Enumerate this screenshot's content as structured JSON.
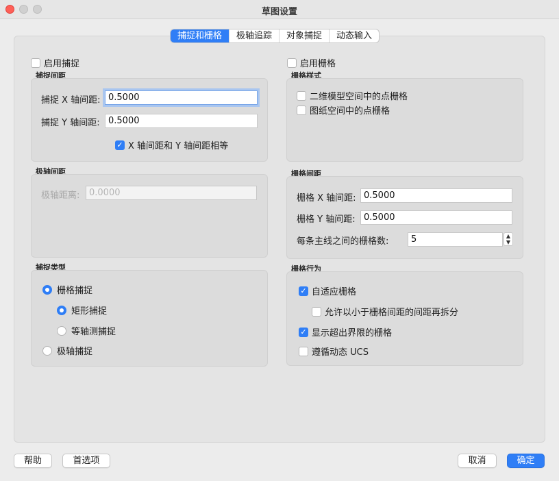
{
  "window": {
    "title": "草图设置"
  },
  "tabs": [
    {
      "label": "捕捉和栅格",
      "active": true
    },
    {
      "label": "极轴追踪",
      "active": false
    },
    {
      "label": "对象捕捉",
      "active": false
    },
    {
      "label": "动态输入",
      "active": false
    }
  ],
  "snap": {
    "enable_label": "启用捕捉",
    "enabled": false,
    "spacing_group": "捕捉间距",
    "x_label": "捕捉 X 轴间距:",
    "x_value": "0.5000",
    "y_label": "捕捉 Y 轴间距:",
    "y_value": "0.5000",
    "equal_label": "X 轴间距和 Y 轴间距相等",
    "equal_checked": true
  },
  "polar": {
    "group": "极轴间距",
    "distance_label": "极轴距离:",
    "distance_value": "0.0000"
  },
  "snap_type": {
    "group": "捕捉类型",
    "grid_snap": "栅格捕捉",
    "rect_snap": "矩形捕捉",
    "iso_snap": "等轴测捕捉",
    "polar_snap": "极轴捕捉",
    "selected": "grid_snap/rect_snap"
  },
  "grid": {
    "enable_label": "启用栅格",
    "enabled": false,
    "style_group": "栅格样式",
    "style_2d": "二维模型空间中的点栅格",
    "style_paper": "图纸空间中的点栅格",
    "spacing_group": "栅格间距",
    "x_label": "栅格 X 轴间距:",
    "x_value": "0.5000",
    "y_label": "栅格 Y 轴间距:",
    "y_value": "0.5000",
    "major_label": "每条主线之间的栅格数:",
    "major_value": "5",
    "behavior_group": "栅格行为",
    "adaptive": "自适应栅格",
    "adaptive_checked": true,
    "subdivide": "允许以小于栅格间距的间距再拆分",
    "subdivide_checked": false,
    "beyond": "显示超出界限的栅格",
    "beyond_checked": true,
    "follow_ucs": "遵循动态 UCS",
    "follow_ucs_checked": false
  },
  "footer": {
    "help": "帮助",
    "options": "首选项",
    "cancel": "取消",
    "ok": "确定"
  },
  "colors": {
    "accent": "#2f7ef6"
  }
}
